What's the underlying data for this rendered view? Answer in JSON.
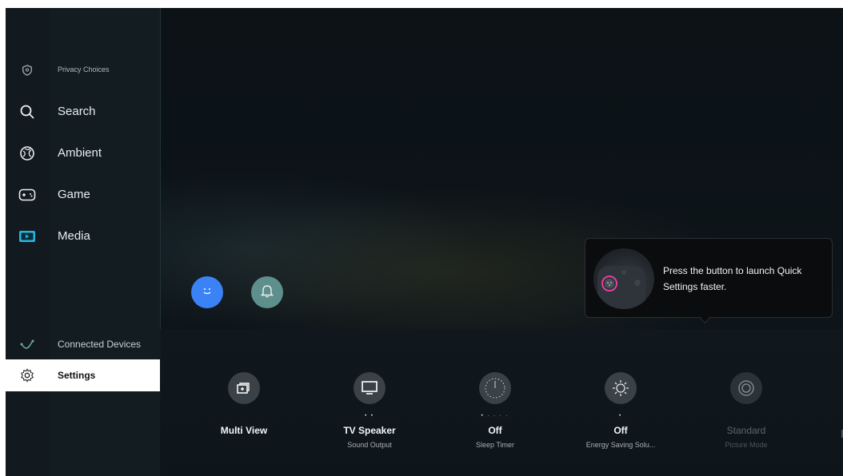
{
  "sidebar": {
    "items": [
      {
        "label": "Privacy Choices",
        "icon": "shield-icon"
      },
      {
        "label": "Search",
        "icon": "search-icon"
      },
      {
        "label": "Ambient",
        "icon": "ambient-icon"
      },
      {
        "label": "Game",
        "icon": "gamepad-icon"
      },
      {
        "label": "Media",
        "icon": "media-icon"
      },
      {
        "label": "Connected Devices",
        "icon": "connected-devices-icon"
      },
      {
        "label": "Settings",
        "icon": "gear-icon"
      }
    ],
    "selected": "Settings"
  },
  "round_buttons": [
    {
      "icon": "smiley-icon",
      "color": "#3b82f6"
    },
    {
      "icon": "bell-icon",
      "color": "#5f8f8c"
    }
  ],
  "tooltip": {
    "text": "Press the button to launch Quick Settings faster."
  },
  "quick_settings": [
    {
      "title": "Multi View",
      "subtitle": "",
      "icon": "multi-view-icon",
      "dots": ""
    },
    {
      "title": "TV Speaker",
      "subtitle": "Sound Output",
      "icon": "tv-icon",
      "dots": "• •"
    },
    {
      "title": "Off",
      "subtitle": "Sleep Timer",
      "icon": "clock-icon",
      "dots": "• · · · ·"
    },
    {
      "title": "Off",
      "subtitle": "Energy Saving Solu...",
      "icon": "energy-icon",
      "dots": "•"
    },
    {
      "title": "Standard",
      "subtitle": "Picture Mode",
      "icon": "picture-mode-icon",
      "dots": ""
    }
  ],
  "colors": {
    "background": "#0d1419",
    "sidebar": "#131c21",
    "selected": "#ffffff",
    "accent_blue": "#3b82f6",
    "accent_pink": "#e040a0"
  }
}
